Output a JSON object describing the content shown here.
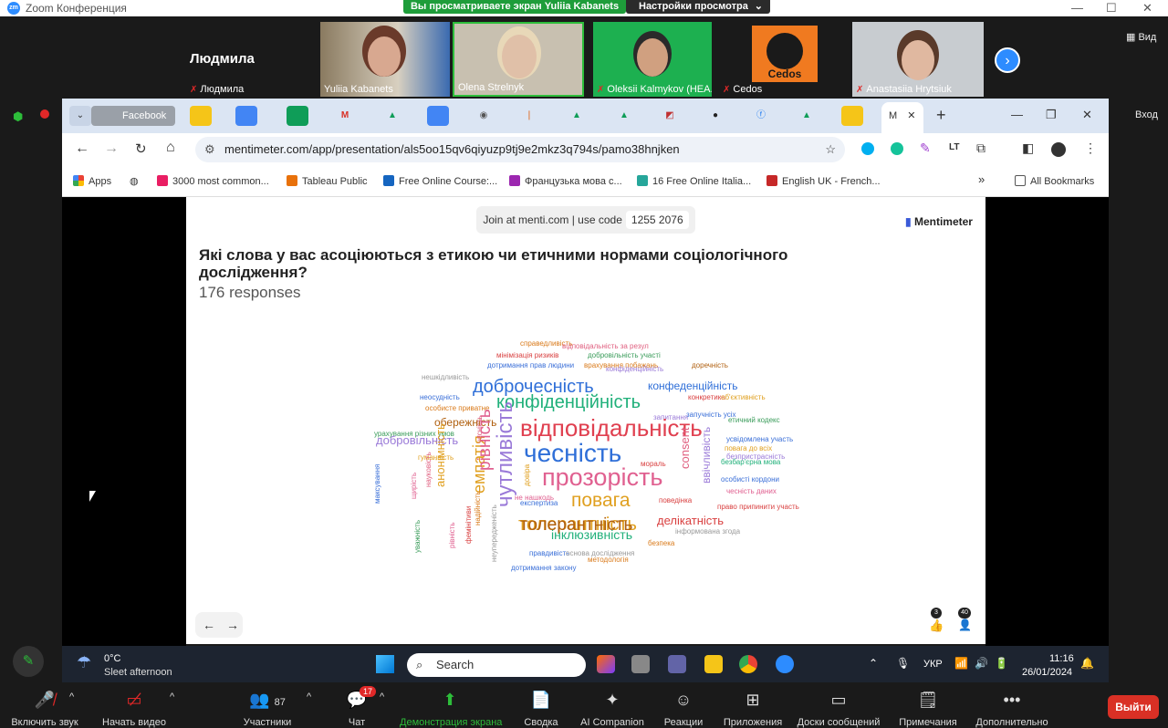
{
  "zoom": {
    "window_title": "Zoom Конференция",
    "share_banner": "Вы просматриваете экран Yuliia Kabanets",
    "view_options": "Настройки просмотра",
    "view_label": "Вид",
    "exit_fullscreen": "Вход",
    "participants": [
      {
        "name": "Людмила",
        "big_name": "Людмила",
        "muted": true
      },
      {
        "name": "Yuliia Kabanets",
        "muted": false
      },
      {
        "name": "Olena Strelnyk",
        "muted": false
      },
      {
        "name": "Oleksii Kalmykov (HEA...",
        "muted": true
      },
      {
        "name": "Cedos",
        "muted": true
      },
      {
        "name": "Anastasiia Hrytsiuk",
        "muted": true
      }
    ],
    "cedos_logo": "Cedos",
    "toolbar": {
      "mute": "Включить звук",
      "video": "Начать видео",
      "participants": "Участники",
      "participants_count": "87",
      "chat": "Чат",
      "chat_badge": "17",
      "share": "Демонстрация экрана",
      "summary": "Сводка",
      "ai": "AI Companion",
      "reactions": "Реакции",
      "apps": "Приложения",
      "whiteboards": "Доски сообщений",
      "notes": "Примечания",
      "more": "Дополнительно",
      "leave": "Выйти"
    }
  },
  "browser": {
    "tabs": [
      "Facebook"
    ],
    "url": "mentimeter.com/app/presentation/als5oo15qv6qiyuzp9tj9e2mkz3q794s/pamo38hnjken",
    "bookmarks": [
      {
        "label": "Apps",
        "color": "#ea4335"
      },
      {
        "label": "3000 most common...",
        "color": "#e91e63"
      },
      {
        "label": "Tableau Public",
        "color": "#e8710a"
      },
      {
        "label": "Free Online Course:...",
        "color": "#1565c0"
      },
      {
        "label": "Французька мова с...",
        "color": "#9c27b0"
      },
      {
        "label": "16 Free Online Italia...",
        "color": "#26a69a"
      },
      {
        "label": "English UK - French...",
        "color": "#c62828"
      }
    ],
    "all_bookmarks": "All Bookmarks"
  },
  "slide": {
    "join_text": "Join at menti.com | use code",
    "code": "1255 2076",
    "brand": "Mentimeter",
    "question": "Які слова у вас асоціюються з етикою чи етичними нормами соціологічного дослідження?",
    "responses": "176 responses",
    "stats": {
      "reactions": "3",
      "people": "40"
    },
    "words": [
      {
        "t": "справедливість",
        "c": "#d97a1a"
      },
      {
        "t": "відповідальність за резул",
        "c": "#e06080"
      },
      {
        "t": "мінімізація ризиків",
        "c": "#d94040"
      },
      {
        "t": "добровільність участі",
        "c": "#3a9c5a"
      },
      {
        "t": "дотримання прав людини",
        "c": "#3a6fd8"
      },
      {
        "t": "врахування побажань",
        "c": "#d97a1a"
      },
      {
        "t": "доречність",
        "c": "#b06010"
      },
      {
        "t": "конфіденційність",
        "c": "#9a7ad8"
      },
      {
        "t": "нешкідливість",
        "c": "#9a9a9a"
      },
      {
        "t": "доброчесність",
        "c": "#2f6fd8"
      },
      {
        "t": "конфеденційність",
        "c": "#2f6fd8"
      },
      {
        "t": "конфіденційність",
        "c": "#20b07a"
      },
      {
        "t": "неосудність",
        "c": "#3a6fd8"
      },
      {
        "t": "конкретика",
        "c": "#d94040"
      },
      {
        "t": "об'єктивність",
        "c": "#e0a020"
      },
      {
        "t": "особисте приватне",
        "c": "#d97a1a"
      },
      {
        "t": "запитання",
        "c": "#9a7ad8"
      },
      {
        "t": "обережність",
        "c": "#b06010"
      },
      {
        "t": "запучність усіх",
        "c": "#3a6fd8"
      },
      {
        "t": "етичний кодекс",
        "c": "#3a9c5a"
      },
      {
        "t": "відповідальність",
        "c": "#e04050"
      },
      {
        "t": "урахування різних умов",
        "c": "#3a9c5a"
      },
      {
        "t": "добровільність",
        "c": "#9a7ad8"
      },
      {
        "t": "чесність",
        "c": "#2f6fd8"
      },
      {
        "t": "усвідомлена участь",
        "c": "#3a6fd8"
      },
      {
        "t": "повага до всіх",
        "c": "#e0a020"
      },
      {
        "t": "безпристрасність",
        "c": "#9a7ad8"
      },
      {
        "t": "безбар'єрна мова",
        "c": "#20b07a"
      },
      {
        "t": "толерантність",
        "c": "#e0a020"
      },
      {
        "t": "прозорість",
        "c": "#e06090"
      },
      {
        "t": "мораль",
        "c": "#d94040"
      },
      {
        "t": "повага",
        "c": "#e0a020"
      },
      {
        "t": "емпатія",
        "c": "#e0a020"
      },
      {
        "t": "рівність",
        "c": "#e06090"
      },
      {
        "t": "чутливість",
        "c": "#9a7ad8"
      },
      {
        "t": "анонімність",
        "c": "#e0a020"
      },
      {
        "t": "consent",
        "c": "#e06080"
      },
      {
        "t": "ввічливість",
        "c": "#9a7ad8"
      },
      {
        "t": "особисті кордони",
        "c": "#3a6fd8"
      },
      {
        "t": "чесність даних",
        "c": "#e06090"
      },
      {
        "t": "не нашкодь",
        "c": "#e06090"
      },
      {
        "t": "експертиза",
        "c": "#3a6fd8"
      },
      {
        "t": "поведінка",
        "c": "#d94040"
      },
      {
        "t": "право припинити участь",
        "c": "#d94040"
      },
      {
        "t": "делікатність",
        "c": "#d94040"
      },
      {
        "t": "толерантність",
        "c": "#b06010"
      },
      {
        "t": "інклюзивність",
        "c": "#20b07a"
      },
      {
        "t": "інформована згода",
        "c": "#9a9a9a"
      },
      {
        "t": "безпека",
        "c": "#d97a1a"
      },
      {
        "t": "правдивість",
        "c": "#3a6fd8"
      },
      {
        "t": "основа дослідження",
        "c": "#9a9a9a"
      },
      {
        "t": "методологія",
        "c": "#d97a1a"
      },
      {
        "t": "дотримання закону",
        "c": "#3a6fd8"
      },
      {
        "t": "уважність",
        "c": "#3a9c5a"
      },
      {
        "t": "рівність",
        "c": "#e06090"
      },
      {
        "t": "максування",
        "c": "#3a6fd8"
      },
      {
        "t": "щирість",
        "c": "#e06090"
      },
      {
        "t": "довіра",
        "c": "#e0a020"
      },
      {
        "t": "гуманність",
        "c": "#e0a020"
      },
      {
        "t": "чесність",
        "c": "#e06080"
      },
      {
        "t": "науковість",
        "c": "#e06080"
      },
      {
        "t": "фемінітиви",
        "c": "#d94040"
      },
      {
        "t": "надійність",
        "c": "#d97a1a"
      },
      {
        "t": "неупередженість",
        "c": "#9a9a9a"
      }
    ]
  },
  "taskbar": {
    "weather_temp": "0°C",
    "weather_desc": "Sleet afternoon",
    "search": "Search",
    "lang": "УКР",
    "time": "11:16",
    "date": "26/01/2024"
  }
}
